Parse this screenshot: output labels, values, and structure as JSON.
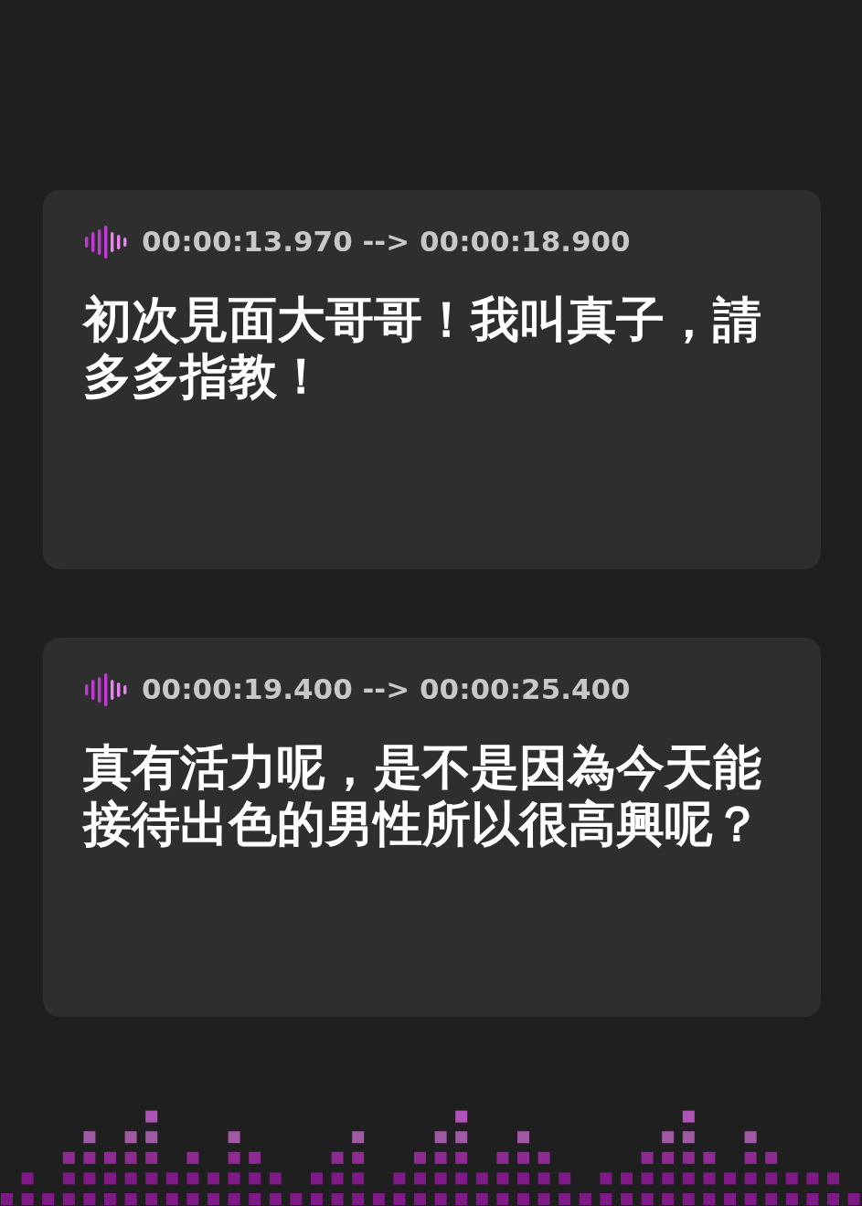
{
  "cards": [
    {
      "timestamp": "00:00:13.970 --> 00:00:18.900",
      "text": "初次見面大哥哥！我叫真子，請多多指教！"
    },
    {
      "timestamp": "00:00:19.400 --> 00:00:25.400",
      "text": "真有活力呢，是不是因為今天能接待出色的男性所以很高興呢？"
    }
  ]
}
